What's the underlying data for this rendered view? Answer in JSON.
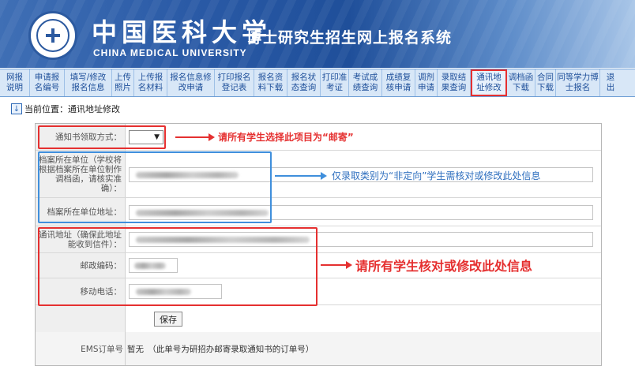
{
  "header": {
    "university_cn": "中国医科大学",
    "university_en": "CHINA MEDICAL UNIVERSITY",
    "system_title": "博士研究生招生网上报名系统"
  },
  "nav": {
    "items": [
      {
        "label": "网报\n说明"
      },
      {
        "label": "申请报\n名编号"
      },
      {
        "label": "填写/修改\n报名信息"
      },
      {
        "label": "上传\n照片"
      },
      {
        "label": "上传报\n名材料"
      },
      {
        "label": "报名信息修\n改申请"
      },
      {
        "label": "打印报名\n登记表"
      },
      {
        "label": "报名资\n料下载"
      },
      {
        "label": "报名状\n态查询"
      },
      {
        "label": "打印准\n考证"
      },
      {
        "label": "考试成\n绩查询"
      },
      {
        "label": "成绩复\n核申请"
      },
      {
        "label": "调剂\n申请"
      },
      {
        "label": "录取结\n果查询"
      },
      {
        "label": "通讯地\n址修改",
        "active": true
      },
      {
        "label": "调档函\n下载"
      },
      {
        "label": "合同\n下载"
      },
      {
        "label": "同等学力博\n士报名"
      },
      {
        "label": "退\n出"
      }
    ]
  },
  "location": {
    "text": "当前位置：通讯地址修改"
  },
  "form": {
    "notice_method_label": "通知书领取方式：",
    "notice_method_value": "",
    "archive_unit_label": "档案所在单位（学校将根据档案所在单位制作调档函，请核实准确）：",
    "archive_address_label": "档案所在单位地址：",
    "mailing_address_label": "通讯地址（确保此地址能收到信件）：",
    "postal_code_label": "邮政编码：",
    "mobile_label": "移动电话：",
    "save_label": "保存",
    "ems_label": "EMS订单号",
    "ems_value": "暂无　（此单号为研招办邮寄录取通知书的订单号）"
  },
  "annotations": {
    "select_post": "请所有学生选择此项目为“邮寄”",
    "non_directed": "仅录取类别为“非定向”学生需核对或修改此处信息",
    "all_check": "请所有学生核对或修改此处信息"
  },
  "colors": {
    "annotation_red": "#e53030",
    "annotation_blue": "#3f8fdc",
    "nav_text": "#1e4f9a",
    "header_blue": "#2a5aa6"
  }
}
